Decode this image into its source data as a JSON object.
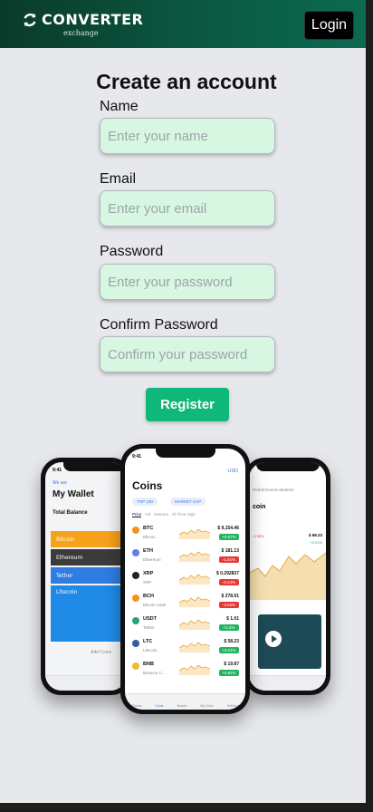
{
  "header": {
    "brand_title": "CONVERTER",
    "brand_sub": "exchange",
    "login_label": "Login"
  },
  "form": {
    "title": "Create an account",
    "fields": [
      {
        "label": "Name",
        "placeholder": "Enter your name"
      },
      {
        "label": "Email",
        "placeholder": "Enter your email"
      },
      {
        "label": "Password",
        "placeholder": "Enter your password"
      },
      {
        "label": "Confirm Password",
        "placeholder": "Confirm your password"
      }
    ],
    "register_label": "Register"
  },
  "phones": {
    "left": {
      "time": "9:41",
      "we_are": "We are",
      "title": "My Wallet",
      "total": "Total Balance",
      "cards": [
        "Bitcoin",
        "Ethereum",
        "Tether",
        "Litecoin"
      ],
      "card_colors": [
        "#f7a21b",
        "#3b3b3b",
        "#2f7de1",
        "#1f8be6"
      ],
      "add": "Add Coins"
    },
    "center": {
      "time": "9:41",
      "currency": "USD",
      "title": "Coins",
      "chips": [
        "TOP 100",
        "MARKET CAP"
      ],
      "tabs": [
        "Price",
        "Vol",
        "Returns",
        "All Time High"
      ],
      "coins": [
        {
          "sym": "BTC",
          "name": "Bitcoin",
          "price": "$ 9,154.46",
          "chg": "+0.67%",
          "up": true,
          "color": "#f7931a"
        },
        {
          "sym": "ETH",
          "name": "Ethereum",
          "price": "$ 181.13",
          "chg": "-1.61%",
          "up": false,
          "color": "#627eea"
        },
        {
          "sym": "XRP",
          "name": "XRP",
          "price": "$ 0.292837",
          "chg": "-0.44%",
          "up": false,
          "color": "#222222"
        },
        {
          "sym": "BCH",
          "name": "Bitcoin Cash",
          "price": "$ 278.91",
          "chg": "-2.52%",
          "up": false,
          "color": "#f7931a"
        },
        {
          "sym": "USDT",
          "name": "Tether",
          "price": "$ 1.01",
          "chg": "+0.2%",
          "up": true,
          "color": "#26a17b"
        },
        {
          "sym": "LTC",
          "name": "Litecoin",
          "price": "$ 58.23",
          "chg": "+0.21%",
          "up": true,
          "color": "#345d9d"
        },
        {
          "sym": "BNB",
          "name": "Binance C...",
          "price": "$ 19.87",
          "chg": "+0.82%",
          "up": true,
          "color": "#f3ba2f"
        }
      ],
      "nav": [
        "Tokens",
        "Coins",
        "Search",
        "My Coins",
        "Settings"
      ]
    },
    "right": {
      "title": "coin",
      "tabs": [
        "Reddit",
        "Events",
        "Markets"
      ],
      "price": "$ 58.23",
      "chg1": "-0.35%",
      "chg2": "+0.21%"
    }
  }
}
